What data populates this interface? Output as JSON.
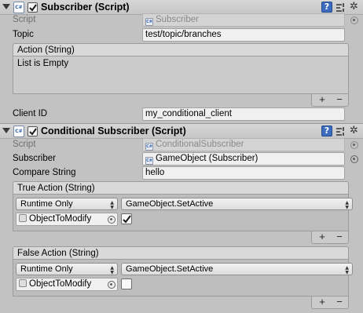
{
  "subscriber": {
    "title": "Subscriber (Script)",
    "icon_text": "C#",
    "enabled": true,
    "script_label": "Script",
    "script_value": "Subscriber",
    "topic_label": "Topic",
    "topic_value": "test/topic/branches",
    "event_header": "Action (String)",
    "empty_text": "List is Empty",
    "client_id_label": "Client ID",
    "client_id_value": "my_conditional_client"
  },
  "conditional": {
    "title": "Conditional Subscriber (Script)",
    "icon_text": "C#",
    "enabled": true,
    "script_label": "Script",
    "script_value": "ConditionalSubscriber",
    "subscriber_label": "Subscriber",
    "subscriber_value": "GameObject (Subscriber)",
    "compare_label": "Compare String",
    "compare_value": "hello",
    "true_action": {
      "header": "True Action (String)",
      "runtime": "Runtime Only",
      "function": "GameObject.SetActive",
      "target": "ObjectToModify",
      "value_checked": true
    },
    "false_action": {
      "header": "False Action (String)",
      "runtime": "Runtime Only",
      "function": "GameObject.SetActive",
      "target": "ObjectToModify",
      "value_checked": false
    }
  },
  "buttons": {
    "add": "+",
    "remove": "−",
    "help": "?",
    "gear": "✲"
  },
  "colors": {
    "help_blue": "#3d6cbf",
    "header": "#d0d0d0",
    "background": "#c2c2c2"
  }
}
